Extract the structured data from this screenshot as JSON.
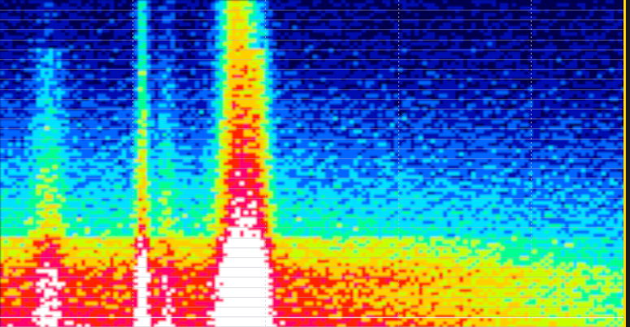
{
  "spectrogram": {
    "view": "waterfall",
    "palette": [
      "#000050",
      "#0010b0",
      "#0066ff",
      "#00e0ff",
      "#00ff90",
      "#c8ff00",
      "#ffd000",
      "#ff2000",
      "#ff0070",
      "#ffffff"
    ],
    "background_color": "#00004a",
    "grid": true,
    "grid_color": "#b4b4c8",
    "time_marker_count": 4,
    "level_meter_color": "#ffd400"
  }
}
